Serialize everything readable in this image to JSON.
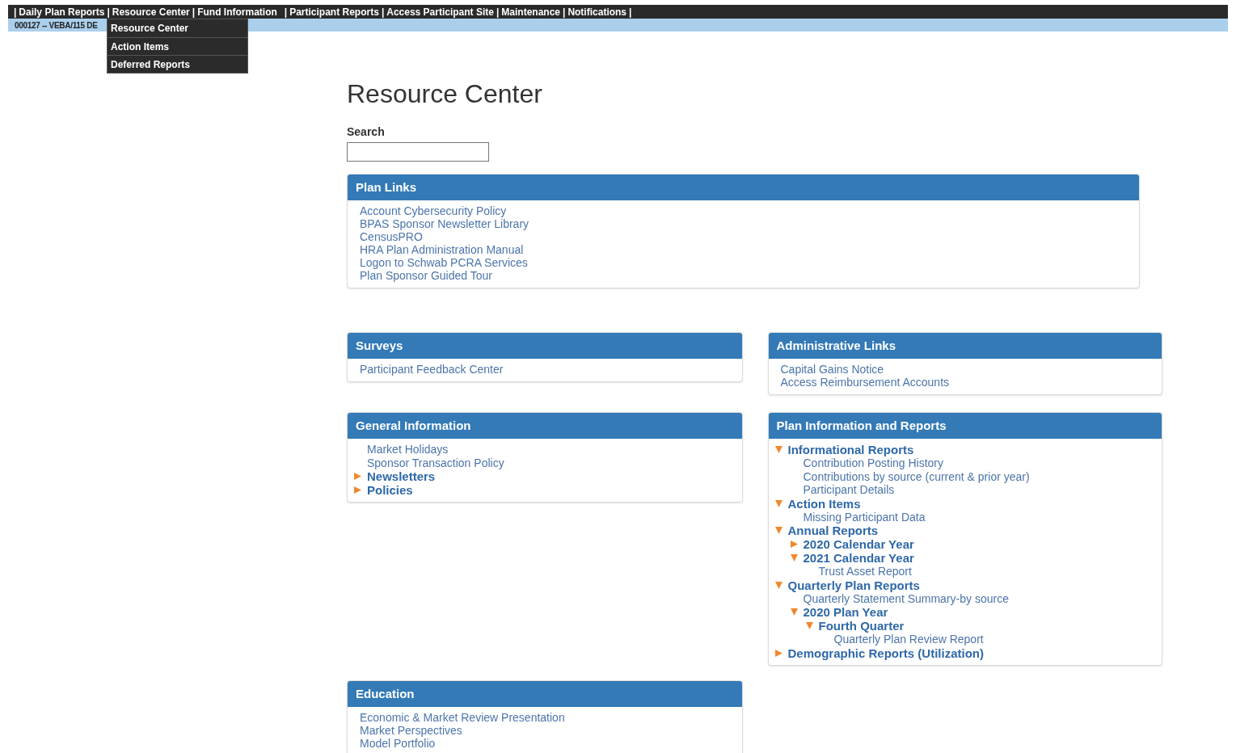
{
  "top_nav": {
    "items": [
      {
        "kind": "separator",
        "label": "|"
      },
      {
        "kind": "link",
        "label": "Daily Plan Reports"
      },
      {
        "kind": "separator",
        "label": "|"
      },
      {
        "kind": "link",
        "label": "Resource Center"
      },
      {
        "kind": "separator",
        "label": "|"
      },
      {
        "kind": "link",
        "label": "Fund Information"
      },
      {
        "kind": "gap"
      },
      {
        "kind": "separator",
        "label": "|"
      },
      {
        "kind": "link",
        "label": "Participant Reports"
      },
      {
        "kind": "separator",
        "label": "|"
      },
      {
        "kind": "link",
        "label": "Access Participant Site"
      },
      {
        "kind": "separator",
        "label": "|"
      },
      {
        "kind": "link",
        "label": "Maintenance"
      },
      {
        "kind": "separator",
        "label": "|"
      },
      {
        "kind": "link",
        "label": "Notifications"
      },
      {
        "kind": "separator",
        "label": "|"
      }
    ]
  },
  "plan_bar": {
    "text": "000127 -- VEBA/115 DE"
  },
  "dropdown_menu": {
    "items": [
      "Resource Center",
      "Action Items",
      "Deferred Reports"
    ]
  },
  "page_title": "Resource Center",
  "search": {
    "label": "Search"
  },
  "plan_links": {
    "title": "Plan Links",
    "links": [
      "Account Cybersecurity Policy",
      "BPAS Sponsor Newsletter Library",
      "CensusPRO",
      "HRA Plan Administration Manual",
      "Logon to Schwab PCRA Services",
      "Plan Sponsor Guided Tour"
    ]
  },
  "columns": [
    {
      "panels": [
        {
          "title": "Surveys",
          "kind": "links",
          "links": [
            "Participant Feedback Center"
          ]
        },
        {
          "title": "General Information",
          "kind": "tree",
          "items": [
            {
              "kind": "link",
              "label": "Market Holidays"
            },
            {
              "kind": "link",
              "label": "Sponsor Transaction Policy"
            },
            {
              "kind": "folder",
              "label": "Newsletters",
              "expanded": false
            },
            {
              "kind": "folder",
              "label": "Policies",
              "expanded": false
            }
          ]
        },
        {
          "title": "Education",
          "kind": "links",
          "links": [
            "Economic & Market Review Presentation",
            "Market Perspectives",
            "Model Portfolio"
          ]
        }
      ]
    },
    {
      "panels": [
        {
          "title": "Administrative Links",
          "kind": "links",
          "links": [
            "Capital Gains Notice",
            "Access Reimbursement Accounts"
          ]
        },
        {
          "title": "Plan Information and Reports",
          "kind": "tree",
          "items": [
            {
              "kind": "folder",
              "label": "Informational Reports",
              "expanded": true,
              "children": [
                {
                  "kind": "link",
                  "label": "Contribution Posting History"
                },
                {
                  "kind": "link",
                  "label": "Contributions by source (current & prior year)"
                },
                {
                  "kind": "link",
                  "label": "Participant Details"
                }
              ]
            },
            {
              "kind": "folder",
              "label": "Action Items",
              "expanded": true,
              "children": [
                {
                  "kind": "link",
                  "label": "Missing Participant Data"
                }
              ]
            },
            {
              "kind": "folder",
              "label": "Annual Reports",
              "expanded": true,
              "children": [
                {
                  "kind": "folder",
                  "label": "2020 Calendar Year",
                  "expanded": false
                },
                {
                  "kind": "folder",
                  "label": "2021 Calendar Year",
                  "expanded": true,
                  "children": [
                    {
                      "kind": "link",
                      "label": "Trust Asset Report"
                    }
                  ]
                }
              ]
            },
            {
              "kind": "folder",
              "label": "Quarterly Plan Reports",
              "expanded": true,
              "children": [
                {
                  "kind": "link",
                  "label": "Quarterly Statement Summary-by source"
                },
                {
                  "kind": "folder",
                  "label": "2020 Plan Year",
                  "expanded": true,
                  "children": [
                    {
                      "kind": "folder",
                      "label": "Fourth Quarter",
                      "expanded": true,
                      "children": [
                        {
                          "kind": "link",
                          "label": "Quarterly Plan Review Report"
                        }
                      ]
                    }
                  ]
                }
              ]
            },
            {
              "kind": "folder",
              "label": "Demographic Reports (Utilization)",
              "expanded": false
            }
          ]
        }
      ]
    }
  ]
}
